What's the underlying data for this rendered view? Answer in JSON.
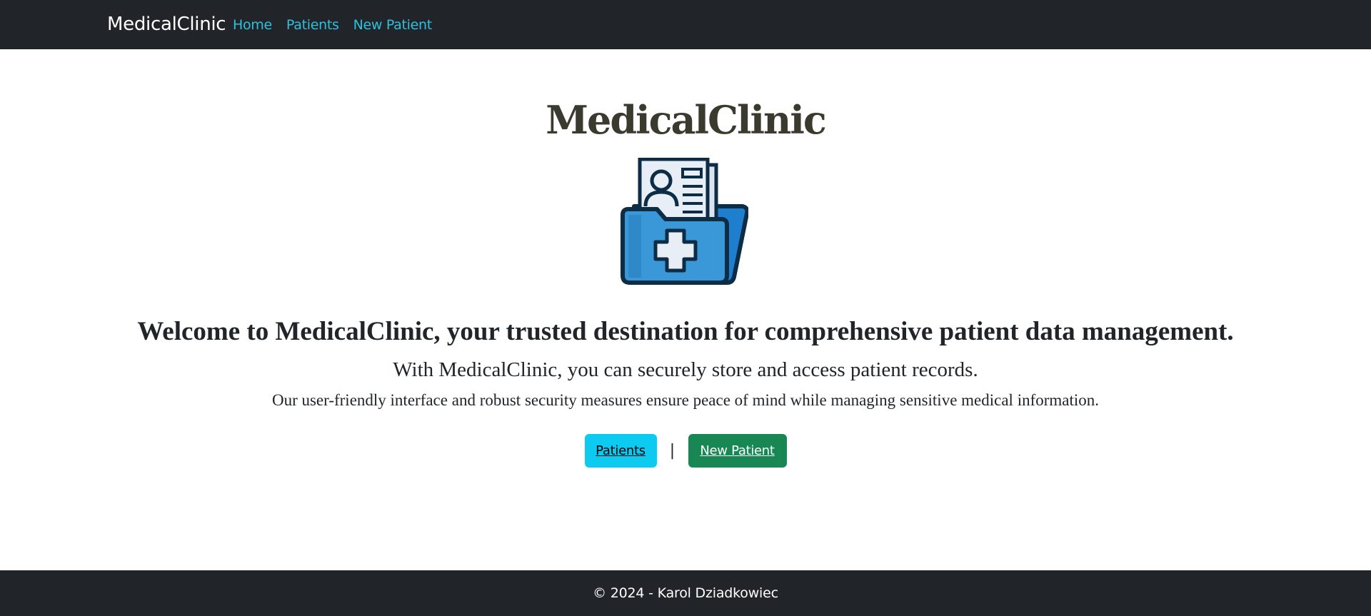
{
  "navbar": {
    "brand": "MedicalClinic",
    "links": [
      {
        "label": "Home"
      },
      {
        "label": "Patients"
      },
      {
        "label": "New Patient"
      }
    ]
  },
  "hero": {
    "title": "MedicalClinic",
    "logo_icon": "medical-records-folder-icon",
    "welcome": "Welcome to MedicalClinic, your trusted destination for comprehensive patient data management.",
    "line2": "With MedicalClinic, you can securely store and access patient records.",
    "line3": "Our user-friendly interface and robust security measures ensure peace of mind while managing sensitive medical information."
  },
  "actions": {
    "patients_label": "Patients",
    "separator": "|",
    "new_patient_label": "New Patient"
  },
  "footer": {
    "text": "© 2024 - Karol Dziadkowiec"
  },
  "colors": {
    "navbar_bg": "#212529",
    "nav_link": "#2fc0dd",
    "btn_info": "#0dcaf0",
    "btn_success": "#198754",
    "title_text": "#3b3a2f"
  }
}
